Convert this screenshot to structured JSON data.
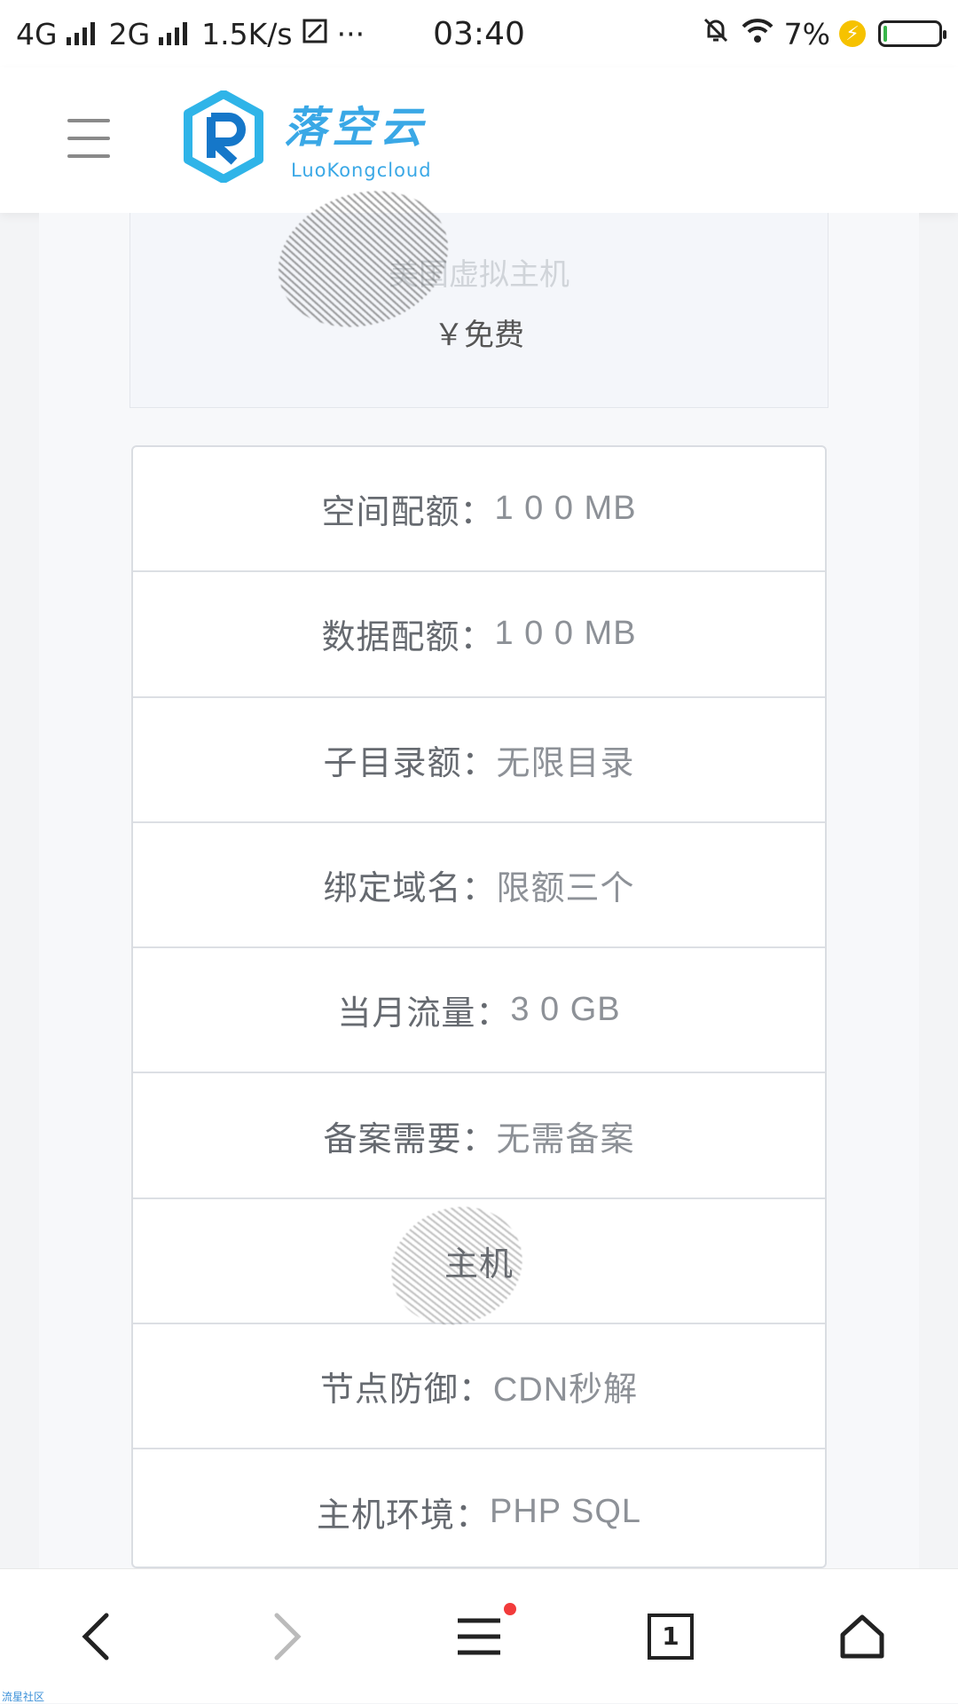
{
  "status_bar": {
    "network_1": "4G",
    "network_2": "2G",
    "speed": "1.5K/s",
    "more": "···",
    "time": "03:40",
    "battery_percent": "7%",
    "battery_level": 0.07,
    "battery_color": "#39b54a"
  },
  "header": {
    "logo_title": "落空云",
    "logo_subtitle": "LuoKongcloud",
    "brand_color": "#3aa8e6"
  },
  "product": {
    "name": "美国虚拟主机",
    "price": "￥免费"
  },
  "specs": [
    {
      "label": "空间配额：",
      "value": "1 0 0 MB"
    },
    {
      "label": "数据配额：",
      "value": "1 0 0 MB"
    },
    {
      "label": "子目录额：",
      "value": "无限目录"
    },
    {
      "label": "绑定域名：",
      "value": "限额三个"
    },
    {
      "label": "当月流量：",
      "value": "3 0 GB"
    },
    {
      "label": "备案需要：",
      "value": "无需备案"
    },
    {
      "label": "主机",
      "value": ""
    },
    {
      "label": "节点防御：",
      "value": "CDN秒解"
    },
    {
      "label": "主机环境：",
      "value": "PHP SQL"
    }
  ],
  "bottom_nav": {
    "tab_count": "1",
    "badge_color": "#f23b3b"
  },
  "watermark": "流星社区"
}
